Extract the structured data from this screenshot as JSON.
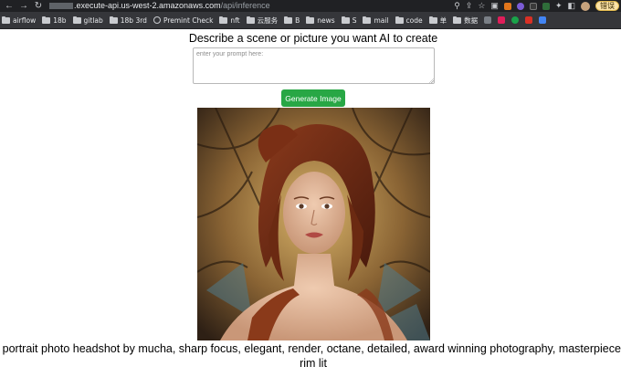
{
  "browser": {
    "url_host": ".execute-api.us-west-2.amazonaws.com",
    "url_path": "/api/inference",
    "error_badge": "错误",
    "nav": {
      "back_icon": "back-arrow-icon",
      "forward_icon": "forward-arrow-icon",
      "reload_icon": "reload-icon"
    }
  },
  "bookmarks": [
    {
      "label": "airflow",
      "icon": "folder-icon"
    },
    {
      "label": "18b",
      "icon": "folder-icon"
    },
    {
      "label": "gitlab",
      "icon": "folder-icon"
    },
    {
      "label": "18b 3rd",
      "icon": "folder-icon"
    },
    {
      "label": "Premint Check",
      "icon": "globe-icon"
    },
    {
      "label": "nft",
      "icon": "folder-icon"
    },
    {
      "label": "云服务",
      "icon": "folder-icon"
    },
    {
      "label": "B",
      "icon": "folder-icon"
    },
    {
      "label": "news",
      "icon": "folder-icon"
    },
    {
      "label": "S",
      "icon": "folder-icon"
    },
    {
      "label": "mail",
      "icon": "folder-icon"
    },
    {
      "label": "code",
      "icon": "folder-icon"
    },
    {
      "label": "单",
      "icon": "folder-icon"
    },
    {
      "label": "数据",
      "icon": "folder-icon"
    }
  ],
  "page": {
    "heading": "Describe a scene or picture you want AI to create",
    "prompt_placeholder": "enter your prompt here:",
    "prompt_value": "",
    "generate_label": "Generate Image",
    "caption": "portrait photo headshot by mucha, sharp focus, elegant, render, octane, detailed, award winning photography, masterpiece, rim lit"
  },
  "colors": {
    "button_bg": "#28a745",
    "chrome_bg": "#202124",
    "bookmarks_bg": "#35363a"
  }
}
